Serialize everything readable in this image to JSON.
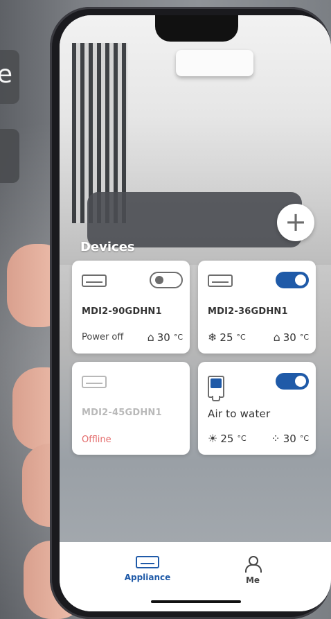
{
  "bg": {
    "side_text_1": "e"
  },
  "screen": {
    "section_title": "Devices",
    "add_symbol": "+"
  },
  "devices": [
    {
      "model": "MDI2-90GDHN1",
      "status_text": "Power off",
      "indoor_temp": "30",
      "unit": "°C",
      "toggle_state": "off"
    },
    {
      "model": "MDI2-36GDHN1",
      "mode_temp": "25",
      "indoor_temp": "30",
      "unit": "°C",
      "toggle_state": "on"
    },
    {
      "model": "MDI2-45GDHN1",
      "status_text": "Offline",
      "toggle_state": "none"
    },
    {
      "model": "Air to water",
      "mode_temp": "25",
      "water_temp": "30",
      "unit": "°C",
      "toggle_state": "on"
    }
  ],
  "tabs": {
    "appliance": "Appliance",
    "me": "Me"
  },
  "colors": {
    "accent": "#1f5aa8",
    "offline": "#e36a6a"
  },
  "icons": {
    "ac": "air-conditioner-icon",
    "heat_pump": "water-heater-icon",
    "home": "home-icon",
    "snow": "snowflake-icon",
    "sun": "sun-icon",
    "drops": "water-drops-icon",
    "me": "person-icon"
  }
}
